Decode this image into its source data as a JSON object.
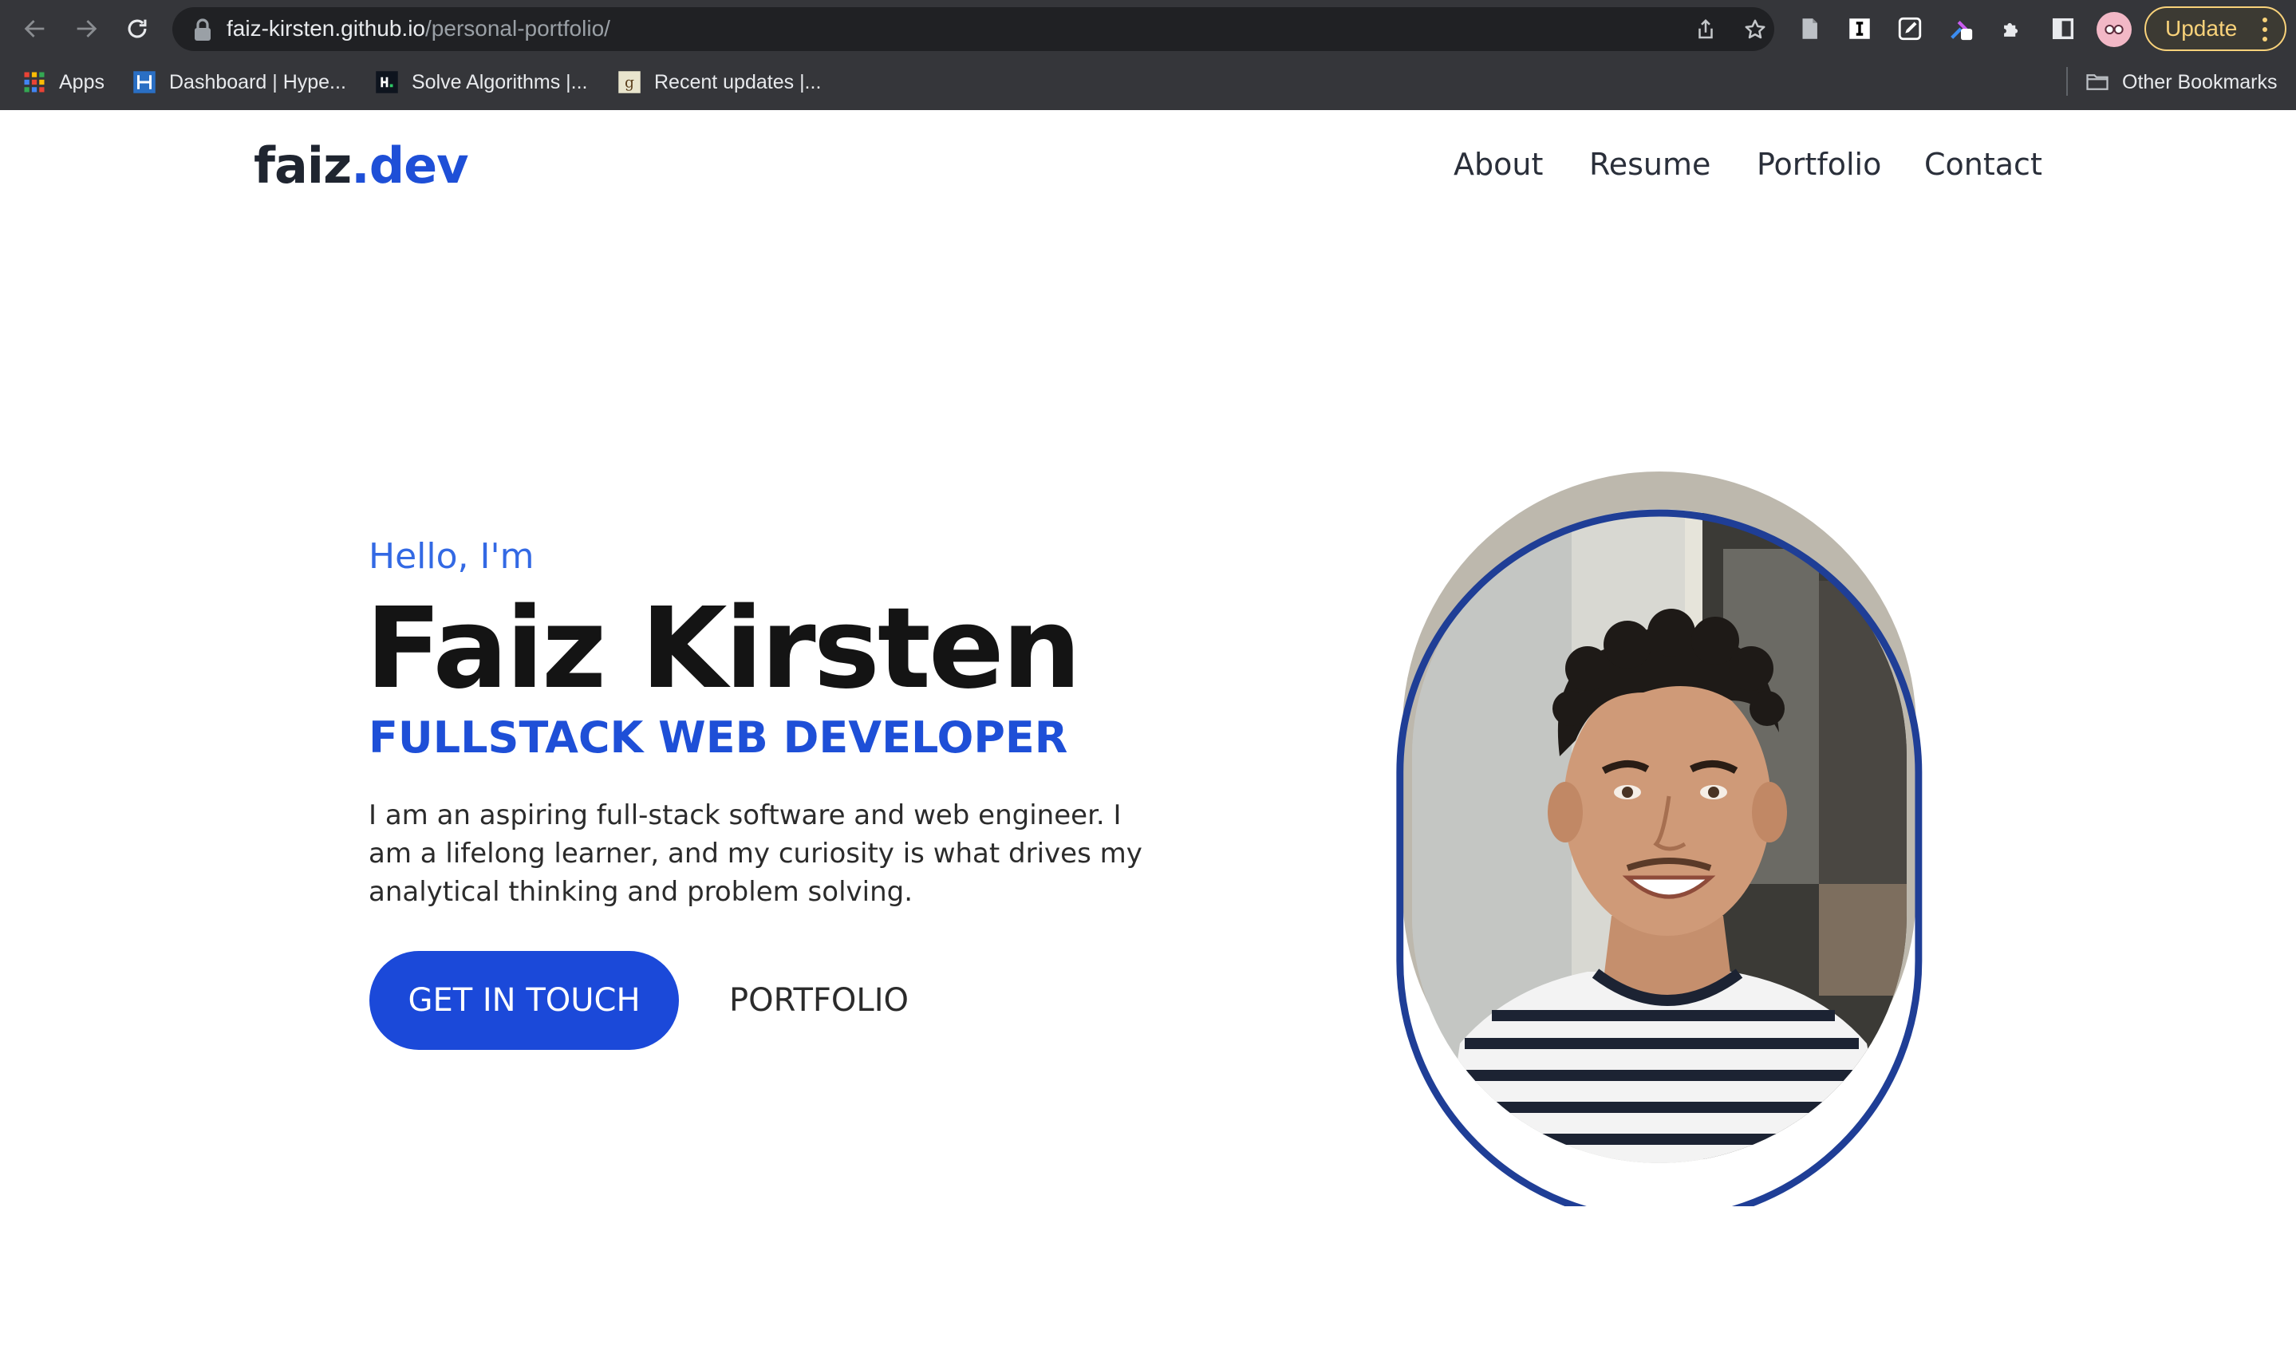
{
  "browser": {
    "url_host": "faiz-kirsten.github.io",
    "url_path": "/personal-portfolio/",
    "update_label": "Update",
    "bookmarks": [
      {
        "label": "Apps",
        "icon": "apps-grid-icon"
      },
      {
        "label": "Dashboard | Hype...",
        "icon": "hyperiondev-favicon"
      },
      {
        "label": "Solve Algorithms |...",
        "icon": "hackerrank-favicon"
      },
      {
        "label": "Recent updates |...",
        "icon": "goodreads-favicon"
      }
    ],
    "other_bookmarks": "Other Bookmarks"
  },
  "site": {
    "logo_main": "faiz",
    "logo_accent": ".dev",
    "nav": [
      "About",
      "Resume",
      "Portfolio",
      "Contact"
    ]
  },
  "hero": {
    "greeting": "Hello, I'm",
    "name": "Faiz Kirsten",
    "role": "FULLSTACK WEB DEVELOPER",
    "bio": "I am an aspiring full-stack software and web engineer. I am a lifelong learner, and my curiosity is what drives my analytical thinking and problem solving.",
    "primary_button": "GET IN TOUCH",
    "secondary_button": "PORTFOLIO"
  },
  "colors": {
    "accent": "#1e4fd7",
    "greeting": "#3369e4",
    "portrait_ring": "#1f3e96",
    "chrome_bg": "#35363a",
    "update_yellow": "#f9d27a"
  }
}
